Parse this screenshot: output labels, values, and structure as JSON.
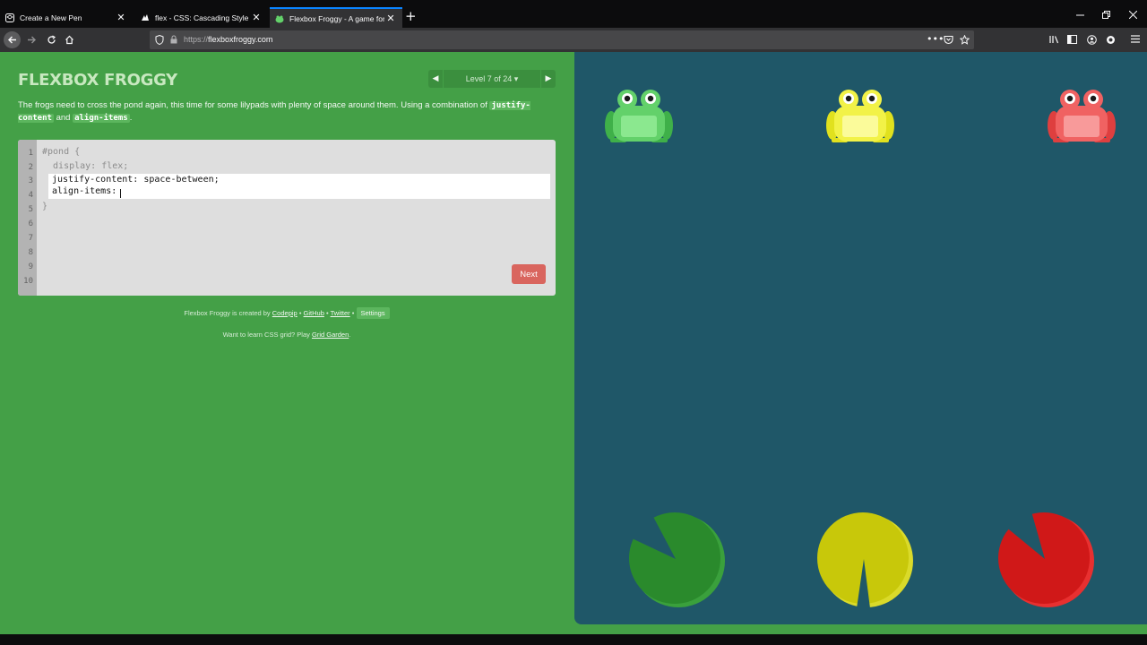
{
  "browser": {
    "tabs": [
      {
        "title": "Create a New Pen",
        "icon": "codepen-icon"
      },
      {
        "title": "flex - CSS: Cascading Style Sheets",
        "icon": "mdn-icon"
      },
      {
        "title": "Flexbox Froggy - A game for learning CSS flexbox",
        "icon": "frog-favicon-icon",
        "active": true
      }
    ],
    "url_scheme": "https://",
    "url_host": "flexboxfroggy.com"
  },
  "game": {
    "logo": "FLEXBOX FROGGY",
    "level_label": "Level 7 of 24 ▾",
    "instructions": {
      "text_before": "The frogs need to cross the pond again, this time for some lilypads with plenty of space around them. Using a combination of ",
      "code1": "justify-content",
      "and": " and ",
      "code2": "align-items",
      "text_after": "."
    },
    "editor": {
      "line_numbers": [
        "1",
        "2",
        "3",
        "4",
        "5",
        "6",
        "7",
        "8",
        "9",
        "10"
      ],
      "line1": "#pond {",
      "line2": "  display: flex;",
      "input_line1": "justify-content: space-between;",
      "input_line2": "align-items:",
      "closing": "}"
    },
    "next_label": "Next"
  },
  "footer": {
    "credit_prefix": "Flexbox Froggy is created by",
    "codepip": "Codepip",
    "bullet": "•",
    "github": "GitHub",
    "twitter": "Twitter",
    "settings": "Settings",
    "promo_text": "Want to learn CSS grid? Play",
    "grid_garden": "Grid Garden",
    "promo_end": "."
  },
  "pond": {
    "frogs": [
      {
        "color": "green",
        "body": "#63d16a",
        "dark": "#3fb049",
        "belly": "#8be88f"
      },
      {
        "color": "yellow",
        "body": "#f2f247",
        "dark": "#e1e11e",
        "belly": "#fbfb9a"
      },
      {
        "color": "red",
        "body": "#f06262",
        "dark": "#de3f3f",
        "belly": "#f89a9a"
      }
    ],
    "lilypads": [
      {
        "color": "green",
        "fill": "#2a8a2c",
        "rim": "#3aa03c"
      },
      {
        "color": "yellow",
        "fill": "#c8c80a",
        "rim": "#dada2a"
      },
      {
        "color": "red",
        "fill": "#d01818",
        "rim": "#e83030"
      }
    ]
  }
}
